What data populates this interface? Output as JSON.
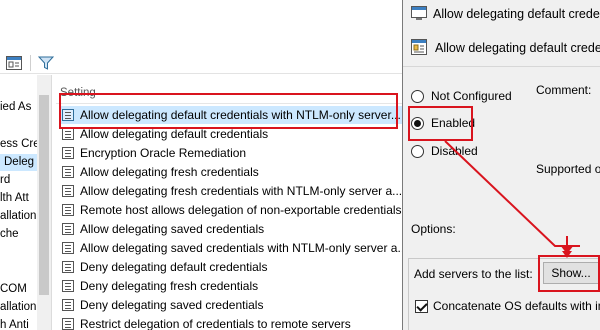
{
  "settings_list": {
    "column_header": "Setting",
    "rows": [
      {
        "label": "Allow delegating default credentials with NTLM-only server..."
      },
      {
        "label": "Allow delegating default credentials"
      },
      {
        "label": "Encryption Oracle Remediation"
      },
      {
        "label": "Allow delegating fresh credentials"
      },
      {
        "label": "Allow delegating fresh credentials with NTLM-only server a..."
      },
      {
        "label": "Remote host allows delegation of non-exportable credentials"
      },
      {
        "label": "Allow delegating saved credentials"
      },
      {
        "label": "Allow delegating saved credentials with NTLM-only server a..."
      },
      {
        "label": "Deny delegating default credentials"
      },
      {
        "label": "Deny delegating fresh credentials"
      },
      {
        "label": "Deny delegating saved credentials"
      },
      {
        "label": "Restrict delegation of credentials to remote servers"
      }
    ]
  },
  "tree": {
    "items": [
      {
        "label": "ied As"
      },
      {
        "label": "ess Cre"
      },
      {
        "label": "Deleg"
      },
      {
        "label": "rd"
      },
      {
        "label": "lth Att"
      },
      {
        "label": "allation"
      },
      {
        "label": "che"
      },
      {
        "label": "COM"
      },
      {
        "label": "allation"
      },
      {
        "label": "h Anti"
      }
    ]
  },
  "dialog": {
    "title": "Allow delegating default credenti",
    "subtitle": "Allow delegating default credenti",
    "radio_not_configured": "Not Configured",
    "radio_enabled": "Enabled",
    "radio_disabled": "Disabled",
    "comment_label": "Comment:",
    "supported_label": "Supported o",
    "options_label": "Options:",
    "add_servers_label": "Add servers to the list:",
    "show_button": "Show...",
    "concatenate_label": "Concatenate OS defaults with inp",
    "selected_option": "Enabled",
    "concatenate_checked": true
  },
  "colors": {
    "highlight": "#d9141e",
    "selection": "#cce8ff",
    "dialog_bg": "#f0f0f0"
  },
  "icons": {
    "toolbar_1": "properties-icon",
    "toolbar_2": "filter-icon",
    "setting": "policy-setting-icon",
    "dialog": "policy-icon"
  }
}
